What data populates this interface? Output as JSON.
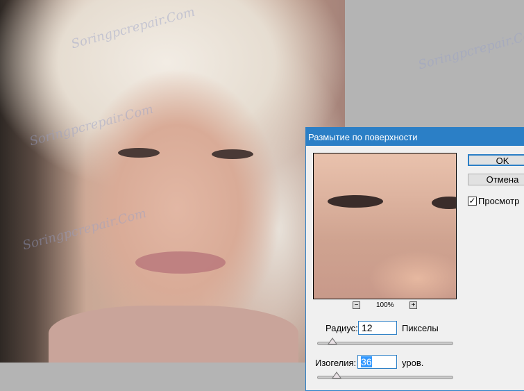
{
  "dialog": {
    "title": "Размытие по поверхности",
    "ok_label": "OK",
    "cancel_label": "Отмена",
    "preview_label": "Просмотр",
    "preview_checked": true,
    "zoom_out": "−",
    "zoom_in": "+",
    "zoom_level": "100%",
    "radius": {
      "label": "Радиус:",
      "value": "12",
      "unit": "Пикселы",
      "slider_fraction": 0.11
    },
    "threshold": {
      "label": "Изогелия:",
      "value": "36",
      "unit": "уров.",
      "slider_fraction": 0.14
    }
  },
  "watermark": "Soringpcrepair.Com"
}
